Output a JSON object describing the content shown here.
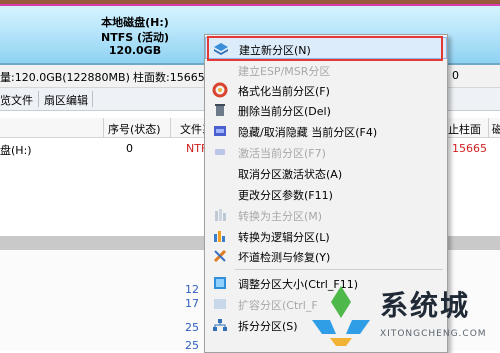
{
  "partition": {
    "name": "本地磁盘(H:)",
    "fs": "NTFS (活动)",
    "size": "120.0GB"
  },
  "infobar": {
    "capacity": "量:120.0GB(122880MB)",
    "cylinders": "柱面数:15665",
    "right_digit": "0"
  },
  "tabs": [
    "览文件",
    "扇区编辑"
  ],
  "table": {
    "headers": [
      "序号(状态)",
      "文件系",
      "止柱面",
      "磁"
    ],
    "row": {
      "name": "盘(H:)",
      "index": "0",
      "fs": "NTF",
      "end": "15665"
    }
  },
  "lower_numbers": [
    "12",
    "17",
    "25",
    "25"
  ],
  "menu": {
    "items": [
      {
        "label": "建立新分区(N)",
        "disabled": false,
        "icon": "layers-icon"
      },
      {
        "label": "建立ESP/MSR分区",
        "disabled": true,
        "icon": "none"
      },
      {
        "label": "格式化当前分区(F)",
        "disabled": false,
        "icon": "format-icon"
      },
      {
        "label": "删除当前分区(Del)",
        "disabled": false,
        "icon": "delete-icon"
      },
      {
        "label": "隐藏/取消隐藏 当前分区(F4)",
        "disabled": false,
        "icon": "hide-icon"
      },
      {
        "label": "激活当前分区(F7)",
        "disabled": true,
        "icon": "activate-icon"
      },
      {
        "label": "取消分区激活状态(A)",
        "disabled": false,
        "icon": "none"
      },
      {
        "label": "更改分区参数(F11)",
        "disabled": false,
        "icon": "none"
      },
      {
        "label": "转换为主分区(M)",
        "disabled": true,
        "icon": "convert-primary-icon"
      },
      {
        "label": "转换为逻辑分区(L)",
        "disabled": false,
        "icon": "convert-logical-icon"
      },
      {
        "label": "坏道检测与修复(Y)",
        "disabled": false,
        "icon": "tools-icon"
      },
      {
        "label": "调整分区大小(Ctrl_F11)",
        "disabled": false,
        "icon": "resize-icon"
      },
      {
        "label": "扩容分区(Ctrl_F",
        "disabled": true,
        "icon": "extend-icon"
      },
      {
        "label": "拆分分区(S)",
        "disabled": false,
        "icon": "split-icon"
      }
    ]
  },
  "watermark": {
    "title": "系统城",
    "url": "XITONGCHENG.COM"
  },
  "colors": {
    "accent": "#2f9ee6",
    "highlight_border": "#e53935",
    "end_cylinder": "#d02020"
  }
}
